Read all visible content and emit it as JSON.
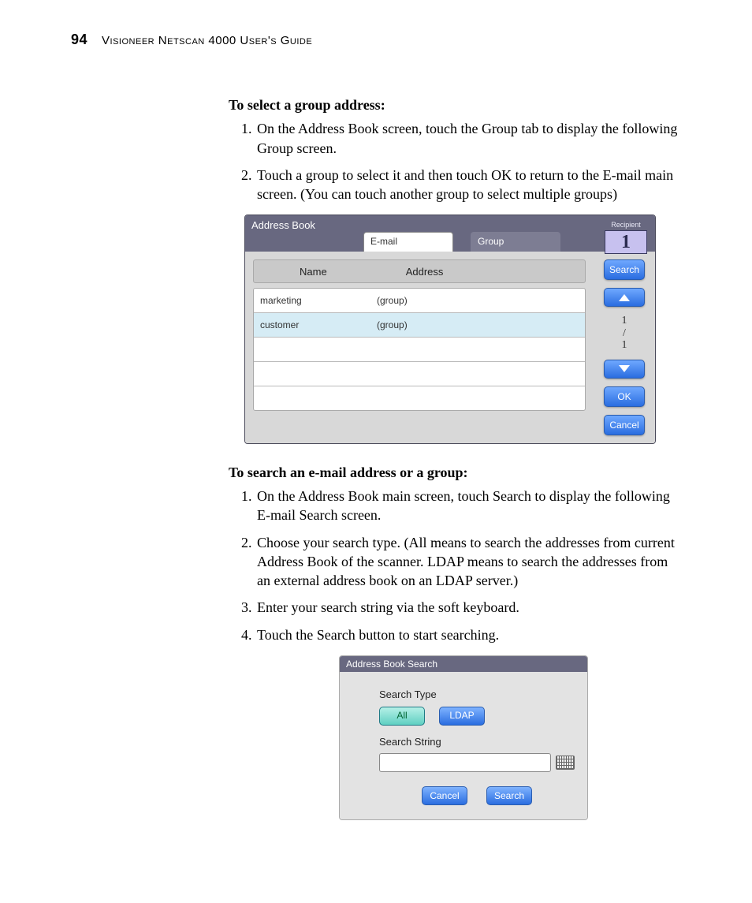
{
  "page": {
    "number": "94",
    "running_title": "Visioneer Netscan 4000 User's Guide"
  },
  "section1": {
    "heading": "To select a group address:",
    "steps": [
      "On the Address Book screen, touch the Group tab to display the following Group screen.",
      "Touch a group to select it and then touch OK to return to the E-mail main screen. (You can touch another group to select multiple groups)"
    ]
  },
  "address_book": {
    "title": "Address Book",
    "tabs": {
      "email": "E-mail",
      "group": "Group"
    },
    "recipient": {
      "label": "Recipient",
      "count": "1"
    },
    "columns": {
      "name": "Name",
      "address": "Address"
    },
    "rows": [
      {
        "name": "marketing",
        "address": "(group)"
      },
      {
        "name": "customer",
        "address": "(group)"
      }
    ],
    "side": {
      "search": "Search",
      "page_current": "1",
      "page_total": "1",
      "ok": "OK",
      "cancel": "Cancel"
    }
  },
  "section2": {
    "heading": "To search an e-mail address or a group:",
    "steps": [
      "On the Address Book main screen, touch Search to display the following E-mail Search screen.",
      "Choose your search type. (All means to search the addresses from current Address Book of the scanner. LDAP means to search the addresses from an external address book on an LDAP server.)",
      "Enter your search string via the soft keyboard.",
      "Touch the Search button to start searching."
    ]
  },
  "search_dialog": {
    "title": "Address Book Search",
    "type_label": "Search Type",
    "type_all": "All",
    "type_ldap": "LDAP",
    "string_label": "Search String",
    "cancel": "Cancel",
    "search": "Search"
  }
}
